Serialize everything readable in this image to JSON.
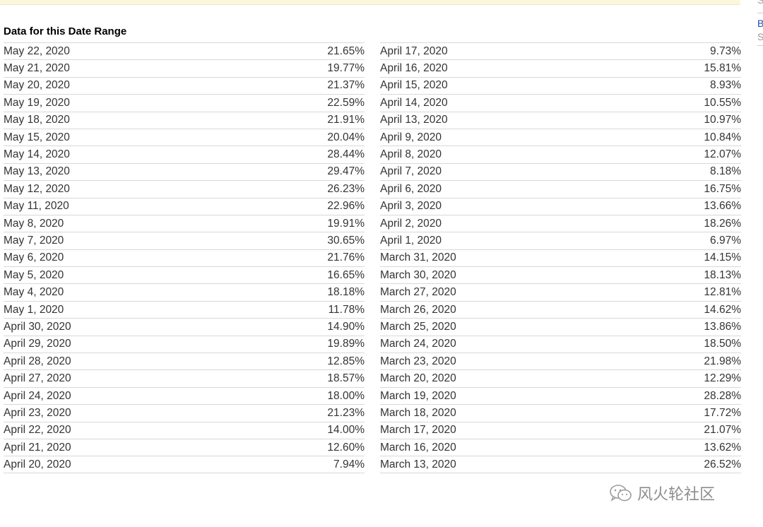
{
  "header": {
    "title": "Data for this Date Range"
  },
  "side_fragments": {
    "s1": "S",
    "b": "B",
    "s2": "S"
  },
  "watermark": {
    "text": "风火轮社区"
  },
  "left_rows": [
    {
      "date": "May 22, 2020",
      "value": "21.65%"
    },
    {
      "date": "May 21, 2020",
      "value": "19.77%"
    },
    {
      "date": "May 20, 2020",
      "value": "21.37%"
    },
    {
      "date": "May 19, 2020",
      "value": "22.59%"
    },
    {
      "date": "May 18, 2020",
      "value": "21.91%"
    },
    {
      "date": "May 15, 2020",
      "value": "20.04%"
    },
    {
      "date": "May 14, 2020",
      "value": "28.44%"
    },
    {
      "date": "May 13, 2020",
      "value": "29.47%"
    },
    {
      "date": "May 12, 2020",
      "value": "26.23%"
    },
    {
      "date": "May 11, 2020",
      "value": "22.96%"
    },
    {
      "date": "May 8, 2020",
      "value": "19.91%"
    },
    {
      "date": "May 7, 2020",
      "value": "30.65%"
    },
    {
      "date": "May 6, 2020",
      "value": "21.76%"
    },
    {
      "date": "May 5, 2020",
      "value": "16.65%"
    },
    {
      "date": "May 4, 2020",
      "value": "18.18%"
    },
    {
      "date": "May 1, 2020",
      "value": "11.78%"
    },
    {
      "date": "April 30, 2020",
      "value": "14.90%"
    },
    {
      "date": "April 29, 2020",
      "value": "19.89%"
    },
    {
      "date": "April 28, 2020",
      "value": "12.85%"
    },
    {
      "date": "April 27, 2020",
      "value": "18.57%"
    },
    {
      "date": "April 24, 2020",
      "value": "18.00%"
    },
    {
      "date": "April 23, 2020",
      "value": "21.23%"
    },
    {
      "date": "April 22, 2020",
      "value": "14.00%"
    },
    {
      "date": "April 21, 2020",
      "value": "12.60%"
    },
    {
      "date": "April 20, 2020",
      "value": "7.94%"
    }
  ],
  "right_rows": [
    {
      "date": "April 17, 2020",
      "value": "9.73%"
    },
    {
      "date": "April 16, 2020",
      "value": "15.81%"
    },
    {
      "date": "April 15, 2020",
      "value": "8.93%"
    },
    {
      "date": "April 14, 2020",
      "value": "10.55%"
    },
    {
      "date": "April 13, 2020",
      "value": "10.97%"
    },
    {
      "date": "April 9, 2020",
      "value": "10.84%"
    },
    {
      "date": "April 8, 2020",
      "value": "12.07%"
    },
    {
      "date": "April 7, 2020",
      "value": "8.18%"
    },
    {
      "date": "April 6, 2020",
      "value": "16.75%"
    },
    {
      "date": "April 3, 2020",
      "value": "13.66%"
    },
    {
      "date": "April 2, 2020",
      "value": "18.26%"
    },
    {
      "date": "April 1, 2020",
      "value": "6.97%"
    },
    {
      "date": "March 31, 2020",
      "value": "14.15%"
    },
    {
      "date": "March 30, 2020",
      "value": "18.13%"
    },
    {
      "date": "March 27, 2020",
      "value": "12.81%"
    },
    {
      "date": "March 26, 2020",
      "value": "14.62%"
    },
    {
      "date": "March 25, 2020",
      "value": "13.86%"
    },
    {
      "date": "March 24, 2020",
      "value": "18.50%"
    },
    {
      "date": "March 23, 2020",
      "value": "21.98%"
    },
    {
      "date": "March 20, 2020",
      "value": "12.29%"
    },
    {
      "date": "March 19, 2020",
      "value": "28.28%"
    },
    {
      "date": "March 18, 2020",
      "value": "17.72%"
    },
    {
      "date": "March 17, 2020",
      "value": "21.07%"
    },
    {
      "date": "March 16, 2020",
      "value": "13.62%"
    },
    {
      "date": "March 13, 2020",
      "value": "26.52%"
    }
  ]
}
